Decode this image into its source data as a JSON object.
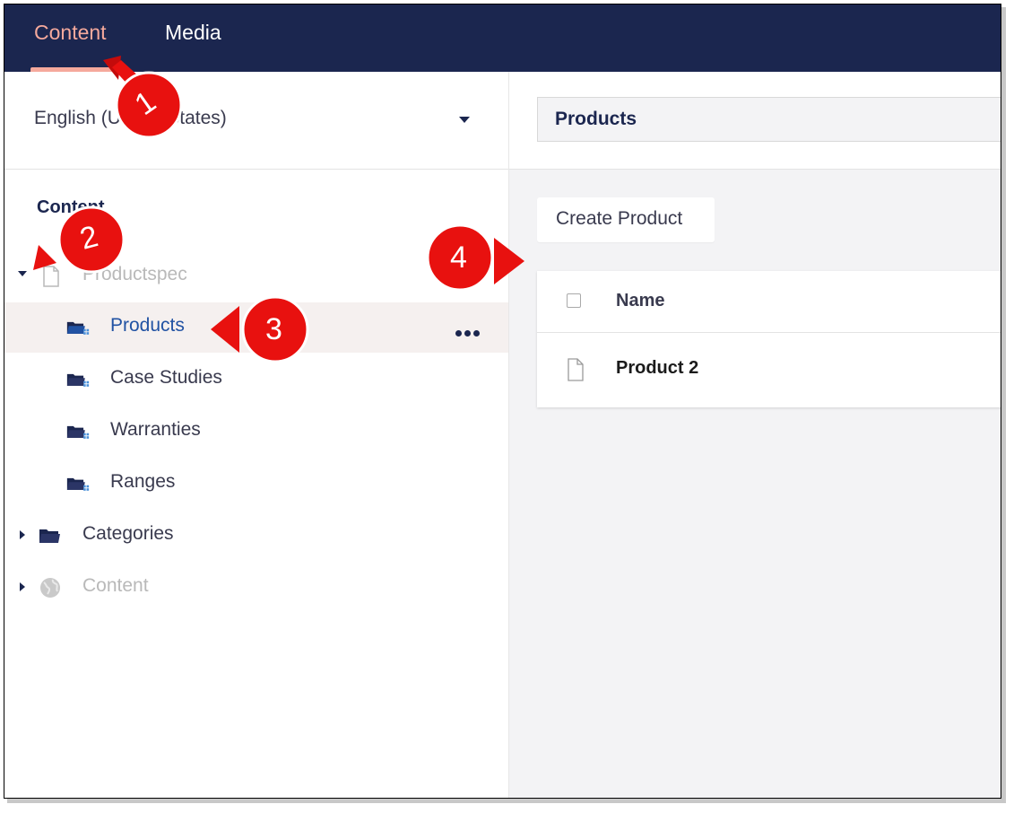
{
  "topnav": {
    "tabs": [
      {
        "label": "Content",
        "active": true
      },
      {
        "label": "Media",
        "active": false
      }
    ]
  },
  "sidebar": {
    "language": "English (United States)",
    "tree_heading": "Content",
    "tree": [
      {
        "label": "Productspec",
        "icon": "document-icon",
        "state": "expanded",
        "muted": true
      },
      {
        "label": "Products",
        "icon": "folder-icon",
        "selected": true
      },
      {
        "label": "Case Studies",
        "icon": "folder-icon"
      },
      {
        "label": "Warranties",
        "icon": "folder-icon"
      },
      {
        "label": "Ranges",
        "icon": "folder-icon"
      },
      {
        "label": "Categories",
        "icon": "folder-icon",
        "state": "collapsed"
      },
      {
        "label": "Content",
        "icon": "globe-icon",
        "state": "collapsed",
        "muted": true
      }
    ]
  },
  "main": {
    "node_name": "Products",
    "create_button": "Create Product",
    "list": {
      "column_name": "Name",
      "rows": [
        {
          "name": "Product 2",
          "icon": "document-icon"
        }
      ]
    }
  },
  "annotations": [
    "1",
    "2",
    "3",
    "4"
  ],
  "colors": {
    "nav_bg": "#1b264f",
    "nav_active": "#f5a99c",
    "selected_row": "#f5f0ef",
    "link_blue": "#2152a3",
    "callout_red": "#e8110f"
  }
}
